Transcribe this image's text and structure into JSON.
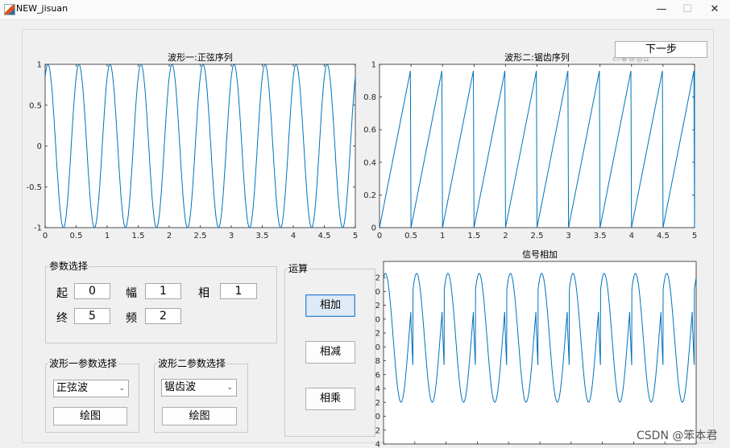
{
  "window": {
    "title": "NEW_jisuan",
    "minimize": "—",
    "maximize": "☐",
    "close": "✕"
  },
  "next_button": "下一步",
  "toolbar_icons": "▭⊕⊖◎⌂",
  "chart_data": [
    {
      "id": "axes1",
      "type": "line",
      "title": "波形一:正弦序列",
      "xlim": [
        0,
        5
      ],
      "ylim": [
        -1,
        1
      ],
      "x_ticks": [
        "0",
        "0.5",
        "1",
        "1.5",
        "2",
        "2.5",
        "3",
        "3.5",
        "4",
        "4.5",
        "5"
      ],
      "y_ticks": [
        "1",
        "0.5",
        "0",
        "-0.5",
        "-1"
      ],
      "series": [
        {
          "function": "sin",
          "amplitude": 1,
          "frequency": 2,
          "phase": 1,
          "color": "#0072bd"
        }
      ]
    },
    {
      "id": "axes2",
      "type": "line",
      "title": "波形二:锯齿序列",
      "xlim": [
        0,
        5
      ],
      "ylim": [
        0,
        1
      ],
      "x_ticks": [
        "0",
        "0.5",
        "1",
        "1.5",
        "2",
        "2.5",
        "3",
        "3.5",
        "4",
        "4.5",
        "5"
      ],
      "y_ticks": [
        "1",
        "0.8",
        "0.6",
        "0.4",
        "0.2",
        "0"
      ],
      "series": [
        {
          "function": "sawtooth",
          "period": 0.5,
          "peak": 0.96,
          "color": "#0072bd"
        }
      ]
    },
    {
      "id": "axes3",
      "type": "line",
      "title": "信号相加",
      "xlim": [
        0,
        5
      ],
      "ylim": [
        -0.4,
        2.6
      ],
      "x_ticks": [],
      "y_ticks": [
        "2",
        "0",
        "2",
        "0",
        "2",
        "0",
        "8",
        "6",
        "4",
        "2",
        "0",
        "2",
        "4"
      ],
      "series": [
        {
          "function": "sin_plus_sawtooth",
          "amplitude": 2.5,
          "frequency": 2,
          "color": "#0072bd"
        }
      ]
    }
  ],
  "params": {
    "title": "参数选择",
    "start_label": "起",
    "start_value": "0",
    "end_label": "终",
    "end_value": "5",
    "amp_label": "幅",
    "amp_value": "1",
    "freq_label": "频",
    "freq_value": "2",
    "phase_label": "相",
    "phase_value": "1"
  },
  "wave1": {
    "title": "波形一参数选择",
    "selected": "正弦波",
    "plot_label": "绘图"
  },
  "wave2": {
    "title": "波形二参数选择",
    "selected": "锯齿波",
    "plot_label": "绘图"
  },
  "ops": {
    "title": "运算",
    "add": "相加",
    "subtract": "相减",
    "multiply": "相乘"
  },
  "watermark": "CSDN @笨本君"
}
